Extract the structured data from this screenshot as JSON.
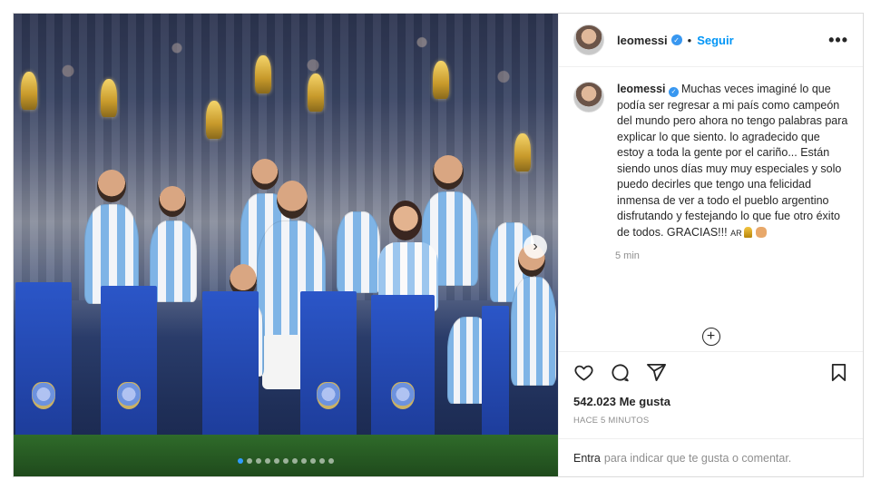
{
  "post": {
    "username": "leomessi",
    "follow_label": "Seguir",
    "separator": "•",
    "more_label": "•••",
    "caption_username": "leomessi",
    "caption": "Muchas veces imaginé lo que podía ser regresar a mi país como campeón del mundo pero ahora no tengo palabras para explicar lo que siento. lo agradecido que estoy a toda la gente por el cariño... Están siendo unos días muy muy especiales y solo puedo decirles que tengo una felicidad inmensa de ver a todo el pueblo argentino disfrutando y festejando lo que fue otro éxito de todos. GRACIAS!!! ",
    "caption_flag": "AR",
    "caption_time": "5 min",
    "likes": "542.023 Me gusta",
    "posted_ago": "Hace 5 minutos",
    "login_link": "Entra",
    "login_text": "para indicar que te gusta o comentar."
  },
  "carousel": {
    "slides": 11,
    "active": 0,
    "next_label": "›"
  },
  "icons": {
    "header": [
      "avatar",
      "verified-icon",
      "more-options-icon"
    ],
    "actions": [
      "heart-icon",
      "comment-icon",
      "share-icon",
      "bookmark-icon"
    ]
  },
  "colors": {
    "link_blue": "#0095f6",
    "verified_blue": "#3897f0",
    "text": "#262626",
    "muted": "#8e8e8e"
  }
}
